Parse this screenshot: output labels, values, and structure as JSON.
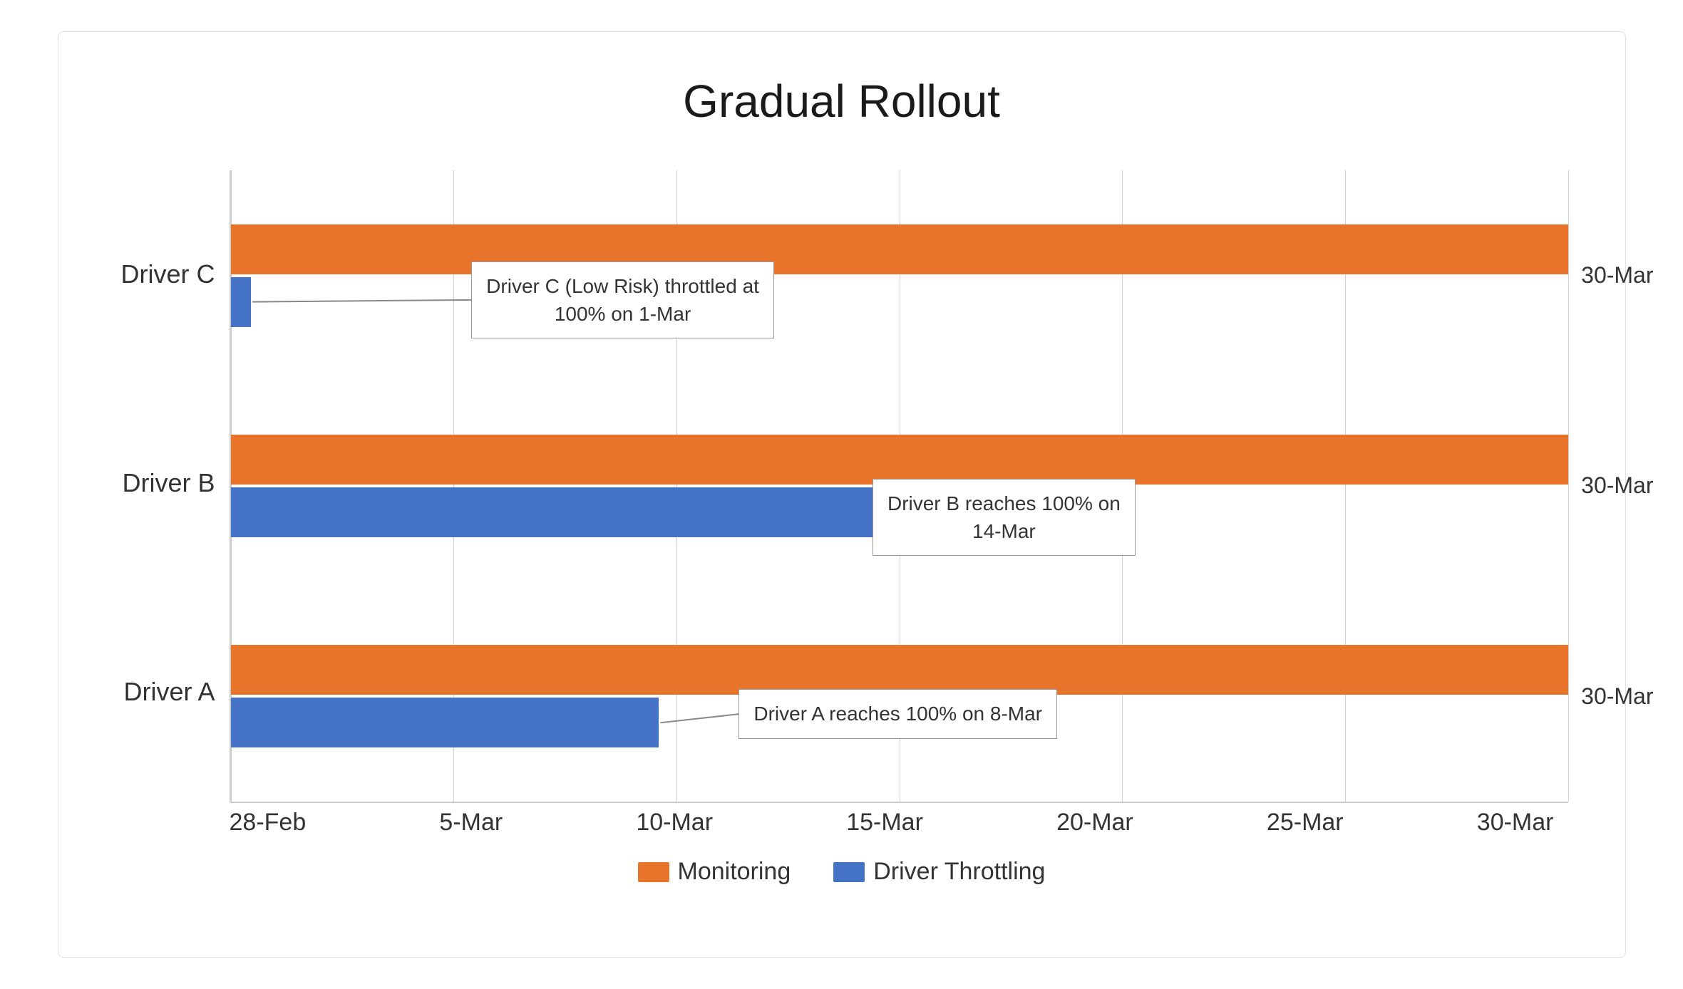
{
  "title": "Gradual Rollout",
  "drivers": [
    {
      "id": "driver-c",
      "label": "Driver C"
    },
    {
      "id": "driver-b",
      "label": "Driver B"
    },
    {
      "id": "driver-a",
      "label": "Driver A"
    }
  ],
  "xAxis": {
    "labels": [
      "28-Feb",
      "5-Mar",
      "10-Mar",
      "15-Mar",
      "20-Mar",
      "25-Mar",
      "30-Mar"
    ],
    "rightLabels": [
      "30-Mar",
      "30-Mar",
      "30-Mar"
    ]
  },
  "callouts": [
    {
      "id": "callout-c",
      "text_line1": "Driver C (Low Risk) throttled at",
      "text_line2": "100% on 1-Mar"
    },
    {
      "id": "callout-b",
      "text_line1": "Driver B reaches 100% on",
      "text_line2": "14-Mar"
    },
    {
      "id": "callout-a",
      "text_line1": "Driver A reaches 100% on 8-Mar",
      "text_line2": ""
    }
  ],
  "legend": {
    "items": [
      {
        "label": "Monitoring",
        "color": "#e8732a"
      },
      {
        "label": "Driver Throttling",
        "color": "#4472c4"
      }
    ]
  },
  "colors": {
    "orange": "#e8732a",
    "blue": "#4472c4",
    "grid": "#d0d0d0",
    "text": "#333333",
    "callout_border": "#999999"
  },
  "bars": {
    "driverC": {
      "orange_pct": 100,
      "blue_pct": 1.5
    },
    "driverB": {
      "orange_pct": 100,
      "blue_pct": 48
    },
    "driverA": {
      "orange_pct": 100,
      "blue_pct": 32
    }
  }
}
